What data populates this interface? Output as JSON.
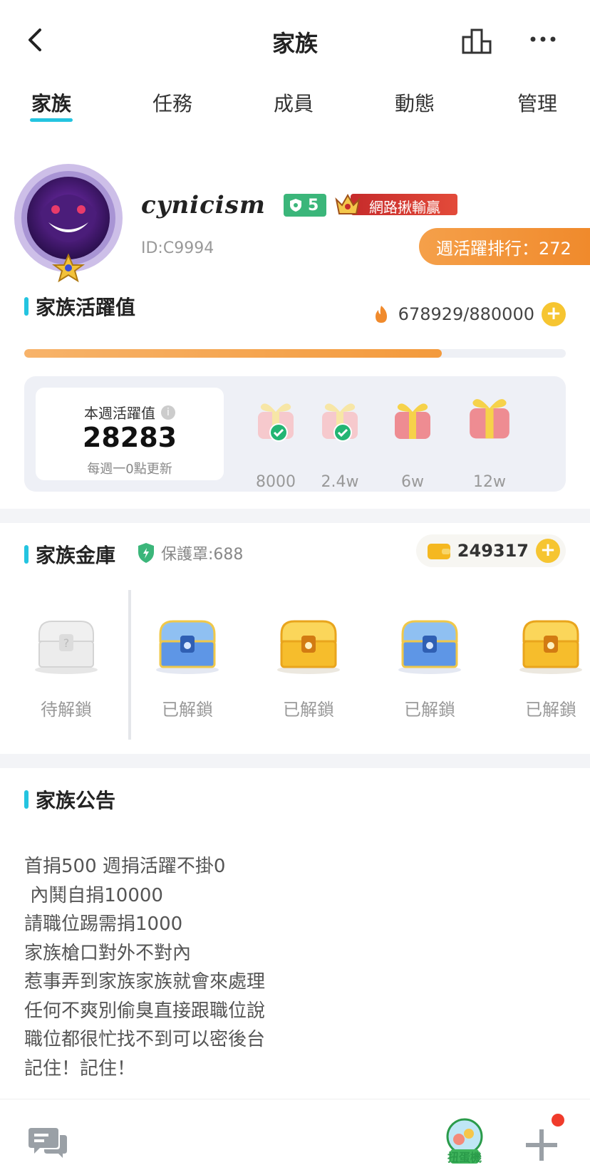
{
  "header": {
    "title": "家族",
    "back_icon": "chevron-left-icon",
    "ranking_icon": "podium-icon",
    "more_icon": "more-dots-icon"
  },
  "tabs": [
    {
      "label": "家族",
      "active": true
    },
    {
      "label": "任務",
      "active": false
    },
    {
      "label": "成員",
      "active": false
    },
    {
      "label": "動態",
      "active": false
    },
    {
      "label": "管理",
      "active": false
    }
  ],
  "profile": {
    "name": "cynicism",
    "level": "5",
    "title_badge": "網路揪輸贏",
    "id": "ID:C9994",
    "weekly_rank": "週活躍排行：272"
  },
  "activity": {
    "heading": "家族活躍值",
    "value": "678929/880000",
    "progress": 0.7715,
    "weekly_label": "本週活躍值",
    "weekly_value": "28283",
    "weekly_note": "每週一0點更新",
    "gifts": [
      {
        "label": "8000",
        "claimed": true
      },
      {
        "label": "2.4w",
        "claimed": true
      },
      {
        "label": "6w",
        "claimed": false
      },
      {
        "label": "12w",
        "claimed": false
      }
    ]
  },
  "vault": {
    "heading": "家族金庫",
    "shield": "保護罩:688",
    "coins": "249317",
    "chests": [
      {
        "label": "待解鎖",
        "type": "grey"
      },
      {
        "label": "已解鎖",
        "type": "blue"
      },
      {
        "label": "已解鎖",
        "type": "gold"
      },
      {
        "label": "已解鎖",
        "type": "blue"
      },
      {
        "label": "已解鎖",
        "type": "gold"
      }
    ]
  },
  "notice": {
    "heading": "家族公告",
    "text": "首捐500 週捐活躍不掛0\n 內鬨自捐10000\n請職位踢需捐1000\n家族槍口對外不對內\n惹事弄到家族家族就會來處理\n任何不爽別偷臭直接跟職位說\n職位都很忙找不到可以密後台\n記住！記住！"
  },
  "bottom_bar": {
    "gacha_label": "扭蛋機"
  },
  "colors": {
    "accent": "#24c4e0",
    "orange": "#f39a3c",
    "green": "#3bb67a",
    "red_badge": "#c62b2b"
  }
}
